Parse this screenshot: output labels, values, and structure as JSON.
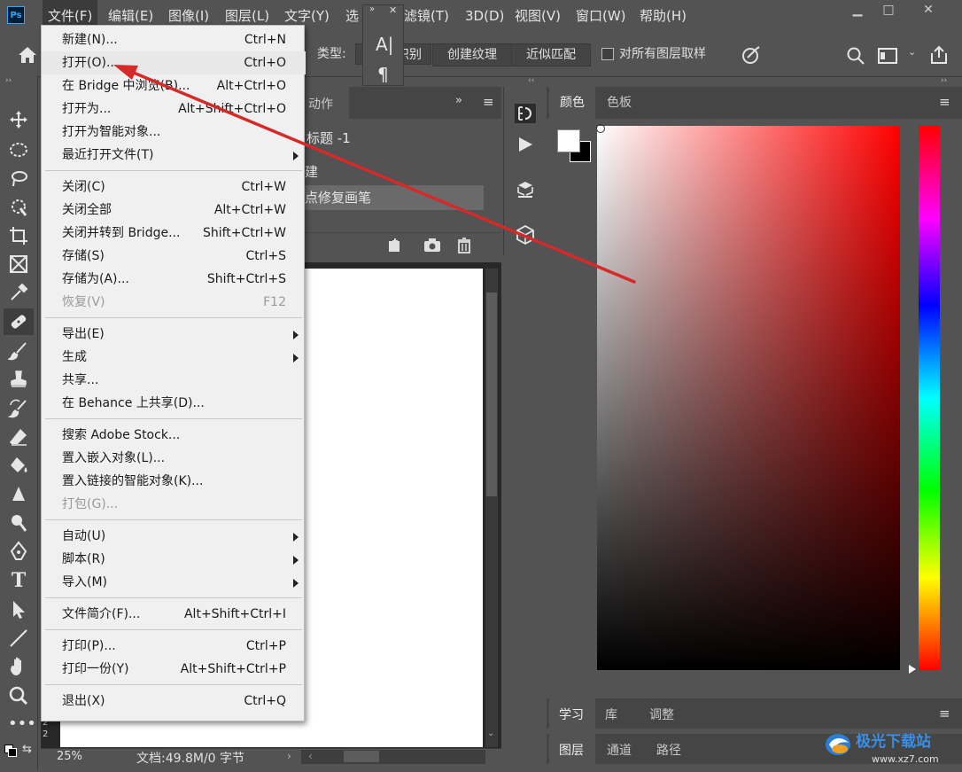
{
  "app": {
    "logo": "Ps"
  },
  "menubar": {
    "items": [
      "文件(F)",
      "编辑(E)",
      "图像(I)",
      "图层(L)",
      "文字(Y)",
      "选",
      "滤镜(T)",
      "3D(D)",
      "视图(V)",
      "窗口(W)",
      "帮助(H)"
    ]
  },
  "window_controls": {
    "minimize": "▁",
    "maximize": "□",
    "close": "✕"
  },
  "options_bar": {
    "type_label": "类型:",
    "seg_partial": "识别",
    "seg_create_texture": "创建纹理",
    "seg_proximity_match": "近似匹配",
    "sample_all_layers": "对所有图层取样"
  },
  "mini_panel": {
    "expand": "»",
    "close": "✕",
    "char_icon": "A|",
    "para_icon": "¶"
  },
  "history_panel": {
    "tab": "动作",
    "expand": "»",
    "rows": [
      "标题 -1",
      "建",
      "点修复画笔"
    ]
  },
  "color_panel": {
    "tabs": [
      "颜色",
      "色板"
    ],
    "accent_fg": "#ffffff",
    "accent_bg": "#000000"
  },
  "learn_panel": {
    "tabs": [
      "学习",
      "库",
      "调整"
    ]
  },
  "layers_panel": {
    "tabs": [
      "图层",
      "通道",
      "路径"
    ]
  },
  "status": {
    "zoom": "25%",
    "doc": "文档:49.8M/0 字节"
  },
  "ruler_marks": [
    "2",
    "2"
  ],
  "file_menu": {
    "groups": [
      [
        {
          "label": "新建(N)...",
          "shortcut": "Ctrl+N"
        },
        {
          "label": "打开(O)...",
          "shortcut": "Ctrl+O"
        },
        {
          "label": "在 Bridge 中浏览(B)...",
          "shortcut": "Alt+Ctrl+O"
        },
        {
          "label": "打开为...",
          "shortcut": "Alt+Shift+Ctrl+O"
        },
        {
          "label": "打开为智能对象...",
          "shortcut": ""
        },
        {
          "label": "最近打开文件(T)",
          "shortcut": "",
          "submenu": true
        }
      ],
      [
        {
          "label": "关闭(C)",
          "shortcut": "Ctrl+W"
        },
        {
          "label": "关闭全部",
          "shortcut": "Alt+Ctrl+W"
        },
        {
          "label": "关闭并转到 Bridge...",
          "shortcut": "Shift+Ctrl+W"
        },
        {
          "label": "存储(S)",
          "shortcut": "Ctrl+S"
        },
        {
          "label": "存储为(A)...",
          "shortcut": "Shift+Ctrl+S"
        },
        {
          "label": "恢复(V)",
          "shortcut": "F12",
          "disabled": true
        }
      ],
      [
        {
          "label": "导出(E)",
          "shortcut": "",
          "submenu": true
        },
        {
          "label": "生成",
          "shortcut": "",
          "submenu": true
        },
        {
          "label": "共享...",
          "shortcut": ""
        },
        {
          "label": "在 Behance 上共享(D)...",
          "shortcut": ""
        }
      ],
      [
        {
          "label": "搜索 Adobe Stock...",
          "shortcut": ""
        },
        {
          "label": "置入嵌入对象(L)...",
          "shortcut": ""
        },
        {
          "label": "置入链接的智能对象(K)...",
          "shortcut": ""
        },
        {
          "label": "打包(G)...",
          "shortcut": "",
          "disabled": true
        }
      ],
      [
        {
          "label": "自动(U)",
          "shortcut": "",
          "submenu": true
        },
        {
          "label": "脚本(R)",
          "shortcut": "",
          "submenu": true
        },
        {
          "label": "导入(M)",
          "shortcut": "",
          "submenu": true
        }
      ],
      [
        {
          "label": "文件简介(F)...",
          "shortcut": "Alt+Shift+Ctrl+I"
        }
      ],
      [
        {
          "label": "打印(P)...",
          "shortcut": "Ctrl+P"
        },
        {
          "label": "打印一份(Y)",
          "shortcut": "Alt+Shift+Ctrl+P"
        }
      ],
      [
        {
          "label": "退出(X)",
          "shortcut": "Ctrl+Q"
        }
      ]
    ]
  },
  "annotation": {
    "arrow_color": "#d42a2a"
  },
  "watermark": {
    "text": "极光下载站",
    "url_text": "www.xz7.com"
  }
}
